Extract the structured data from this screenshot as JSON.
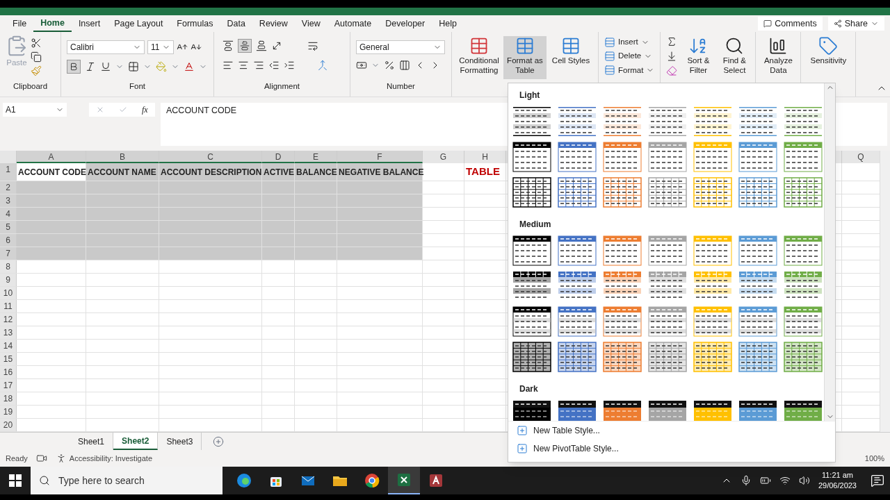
{
  "ribbon": {
    "tabs": [
      {
        "label": "File",
        "selected": false
      },
      {
        "label": "Home",
        "selected": true
      },
      {
        "label": "Insert",
        "selected": false
      },
      {
        "label": "Page Layout",
        "selected": false
      },
      {
        "label": "Formulas",
        "selected": false
      },
      {
        "label": "Data",
        "selected": false
      },
      {
        "label": "Review",
        "selected": false
      },
      {
        "label": "View",
        "selected": false
      },
      {
        "label": "Automate",
        "selected": false
      },
      {
        "label": "Developer",
        "selected": false
      },
      {
        "label": "Help",
        "selected": false
      }
    ],
    "comments": "Comments",
    "share": "Share",
    "clipboard": {
      "label": "Clipboard",
      "paste": "Paste"
    },
    "font": {
      "label": "Font",
      "name": "Calibri",
      "size": "11",
      "bold": true
    },
    "alignment": {
      "label": "Alignment",
      "middle_align": true
    },
    "number": {
      "label": "Number",
      "format": "General"
    },
    "commands": [
      {
        "label": "Conditional Formatting",
        "selected": false
      },
      {
        "label": "Format as Table",
        "selected": true
      },
      {
        "label": "Cell Styles",
        "selected": false
      }
    ],
    "cells": [
      "Insert",
      "Delete",
      "Format"
    ],
    "editing": [
      "Sort & Filter",
      "Find & Select"
    ],
    "analyze": "Analyze Data",
    "sensitivity": "Sensitivity"
  },
  "formula_bar": {
    "cell": "A1",
    "fx": "fx",
    "value": "ACCOUNT CODE"
  },
  "sheet": {
    "columns": [
      {
        "label": "A",
        "selected": true
      },
      {
        "label": "B",
        "selected": true
      },
      {
        "label": "C",
        "selected": true
      },
      {
        "label": "D",
        "selected": true
      },
      {
        "label": "E",
        "selected": true
      },
      {
        "label": "F",
        "selected": true
      },
      {
        "label": "G",
        "selected": false
      },
      {
        "label": "H",
        "selected": false
      }
    ],
    "last_column": "Q",
    "note": "TABLE",
    "rows": [
      {
        "label": "1",
        "selected": true,
        "cells": [
          "ACCOUNT CODE",
          "ACCOUNT NAME",
          "ACCOUNT DESCRIPTION",
          "ACTIVE",
          "BALANCE",
          "NEGATIVE BALANCE"
        ]
      },
      {
        "label": "2",
        "selected": true
      },
      {
        "label": "3",
        "selected": true
      },
      {
        "label": "4",
        "selected": true
      },
      {
        "label": "5",
        "selected": true
      },
      {
        "label": "6",
        "selected": true
      },
      {
        "label": "7",
        "selected": true
      },
      {
        "label": "8",
        "selected": false
      },
      {
        "label": "9",
        "selected": false
      },
      {
        "label": "10",
        "selected": false
      },
      {
        "label": "11",
        "selected": false
      },
      {
        "label": "12",
        "selected": false
      },
      {
        "label": "13",
        "selected": false
      },
      {
        "label": "14",
        "selected": false
      },
      {
        "label": "15",
        "selected": false
      },
      {
        "label": "16",
        "selected": false
      },
      {
        "label": "17",
        "selected": false
      },
      {
        "label": "18",
        "selected": false
      },
      {
        "label": "19",
        "selected": false
      },
      {
        "label": "20",
        "selected": false
      }
    ]
  },
  "gallery": {
    "columns": [
      {
        "color": "#000000"
      },
      {
        "color": "#4472c4"
      },
      {
        "color": "#ed7d31"
      },
      {
        "color": "#a5a5a5"
      },
      {
        "color": "#ffc000"
      },
      {
        "color": "#5b9bd5"
      },
      {
        "color": "#70ad47"
      }
    ],
    "sections": [
      {
        "title": "Light",
        "rows": [
          {
            "kind": "lines"
          },
          {
            "kind": "header"
          },
          {
            "kind": "grid"
          }
        ]
      },
      {
        "title": "Medium",
        "rows": [
          {
            "kind": "header"
          },
          {
            "kind": "banded"
          },
          {
            "kind": "header-lines"
          },
          {
            "kind": "shaded-grid"
          }
        ]
      },
      {
        "title": "Dark",
        "rows": [
          {
            "kind": "dark"
          }
        ]
      }
    ],
    "actions": [
      "New Table Style...",
      "New PivotTable Style..."
    ]
  },
  "sheet_tabs": [
    {
      "label": "Sheet1",
      "selected": false
    },
    {
      "label": "Sheet2",
      "selected": true
    },
    {
      "label": "Sheet3",
      "selected": false
    }
  ],
  "status_bar": {
    "status": "Ready",
    "accessibility": "Accessibility: Investigate",
    "zoom": "100%"
  },
  "taskbar": {
    "search_placeholder": "Type here to search",
    "apps": [
      {
        "kind": "browser",
        "selected": false
      },
      {
        "kind": "store",
        "selected": false
      },
      {
        "kind": "mail",
        "selected": false
      },
      {
        "kind": "folder",
        "selected": false
      },
      {
        "kind": "chrome",
        "selected": false
      },
      {
        "kind": "excel",
        "selected": true
      },
      {
        "kind": "access",
        "selected": false
      }
    ],
    "time": "11:21 am",
    "date": "29/06/2023"
  }
}
